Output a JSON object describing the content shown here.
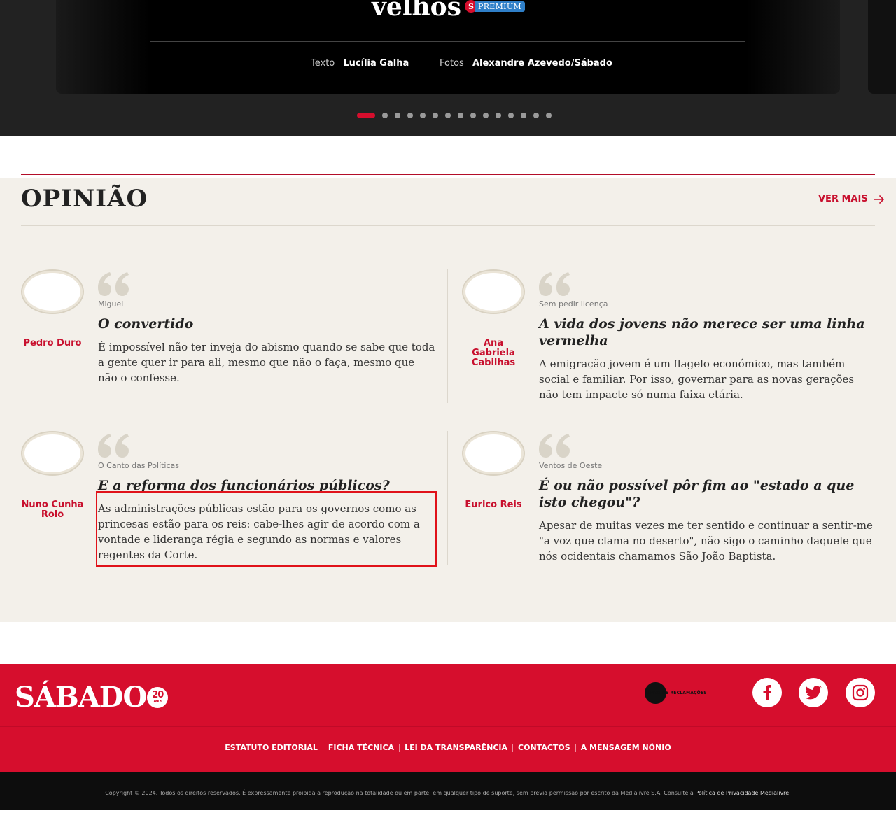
{
  "hero": {
    "title": "velhos",
    "premium_badge": "PREMIUM",
    "premium_letter": "S",
    "text_label": "Texto",
    "text_author": "Lucília Galha",
    "photo_label": "Fotos",
    "photo_author": "Alexandre Azevedo/Sábado",
    "carousel_total": 15,
    "carousel_active": 1
  },
  "opinion": {
    "title": "OPINIÃO",
    "see_more": "VER MAIS",
    "items": [
      {
        "author": "Pedro Duro",
        "column": "Miguel",
        "headline": "O convertido",
        "excerpt": "É impossível não ter inveja do abismo quando se sabe que toda a gente quer ir para ali, mesmo que não o faça, mesmo que não o confesse."
      },
      {
        "author": "Ana Gabriela Cabilhas",
        "column": "Sem pedir licença",
        "headline": "A vida dos jovens não merece ser uma linha vermelha",
        "excerpt": "A emigração jovem é um flagelo económico, mas também social e familiar. Por isso, governar para as novas gerações não tem impacte só numa faixa etária."
      },
      {
        "author": "Nuno Cunha Rolo",
        "column": "O Canto das Políticas",
        "headline": "E a reforma dos funcionários públicos?",
        "excerpt": "As administrações públicas estão para os governos como as princesas estão para os reis: cabe-lhes agir de acordo com a vontade e liderança régia e segundo as normas e valores regentes da Corte."
      },
      {
        "author": "Eurico Reis",
        "column": "Ventos de Oeste",
        "headline": "É ou não possível pôr fim ao \"estado a que isto chegou\"?",
        "excerpt": "Apesar de muitas vezes me ter sentido e continuar a sentir-me \"a voz que clama no deserto\", não sigo o caminho daquele que nós ocidentais chamamos São João Baptista."
      }
    ]
  },
  "footer": {
    "logo_text": "SÁBADO",
    "logo_badge_number": "20",
    "logo_badge_label": "ANOS",
    "complaints_book": "LIVRO DE RECLAMAÇÕES",
    "social": [
      "facebook-icon",
      "twitter-icon",
      "instagram-icon"
    ],
    "links": [
      "ESTATUTO EDITORIAL",
      "FICHA TÉCNICA",
      "LEI DA TRANSPARÊNCIA",
      "CONTACTOS",
      "A MENSAGEM NÓNIO"
    ],
    "copyright": "Copyright © 2024. Todos os direitos reservados. É expressamente proibida a reprodução na totalidade ou em parte, em qualquer tipo de suporte, sem prévia permissão por escrito da Medialivre S.A. Consulte a",
    "privacy_link": "Política de Privacidade Medialivre",
    "copyright_end": "."
  },
  "colors": {
    "brand_red": "#d60e2d",
    "dark_bg": "#222222",
    "opinion_bg": "#f3f0ea",
    "premium_blue": "#2f7fc8"
  }
}
